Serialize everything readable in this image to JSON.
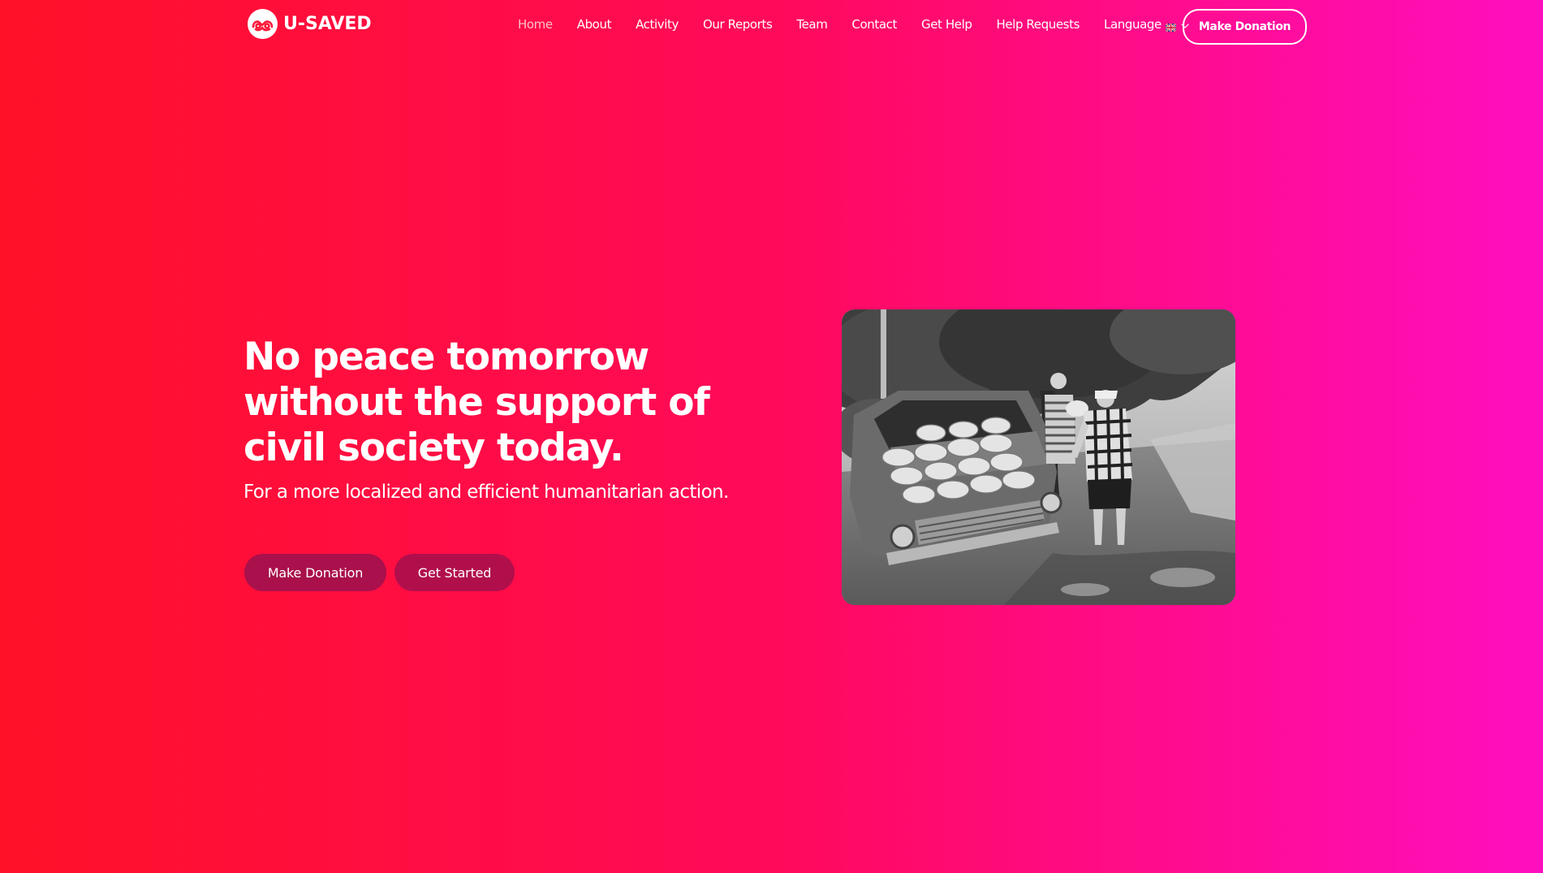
{
  "brand": {
    "name": "U-SAVED"
  },
  "nav": {
    "items": [
      {
        "label": "Home",
        "active": true
      },
      {
        "label": "About"
      },
      {
        "label": "Activity"
      },
      {
        "label": "Our Reports"
      },
      {
        "label": "Team"
      },
      {
        "label": "Contact"
      },
      {
        "label": "Get Help"
      },
      {
        "label": "Help Requests"
      }
    ],
    "language_label": "Language",
    "language_flag_icon": "uk-flag-icon",
    "donate_label": "Make Donation"
  },
  "hero": {
    "title": "No peace tomorrow without the support of civil society today.",
    "subtitle": "For a more localized and efficient humanitarian action.",
    "primary_button": "Make Donation",
    "secondary_button": "Get Started"
  },
  "colors": {
    "gradient_start": "#ff1128",
    "gradient_end": "#ff0ec0",
    "button_bg": "#a9104c",
    "active_nav": "#ffc0c8"
  }
}
